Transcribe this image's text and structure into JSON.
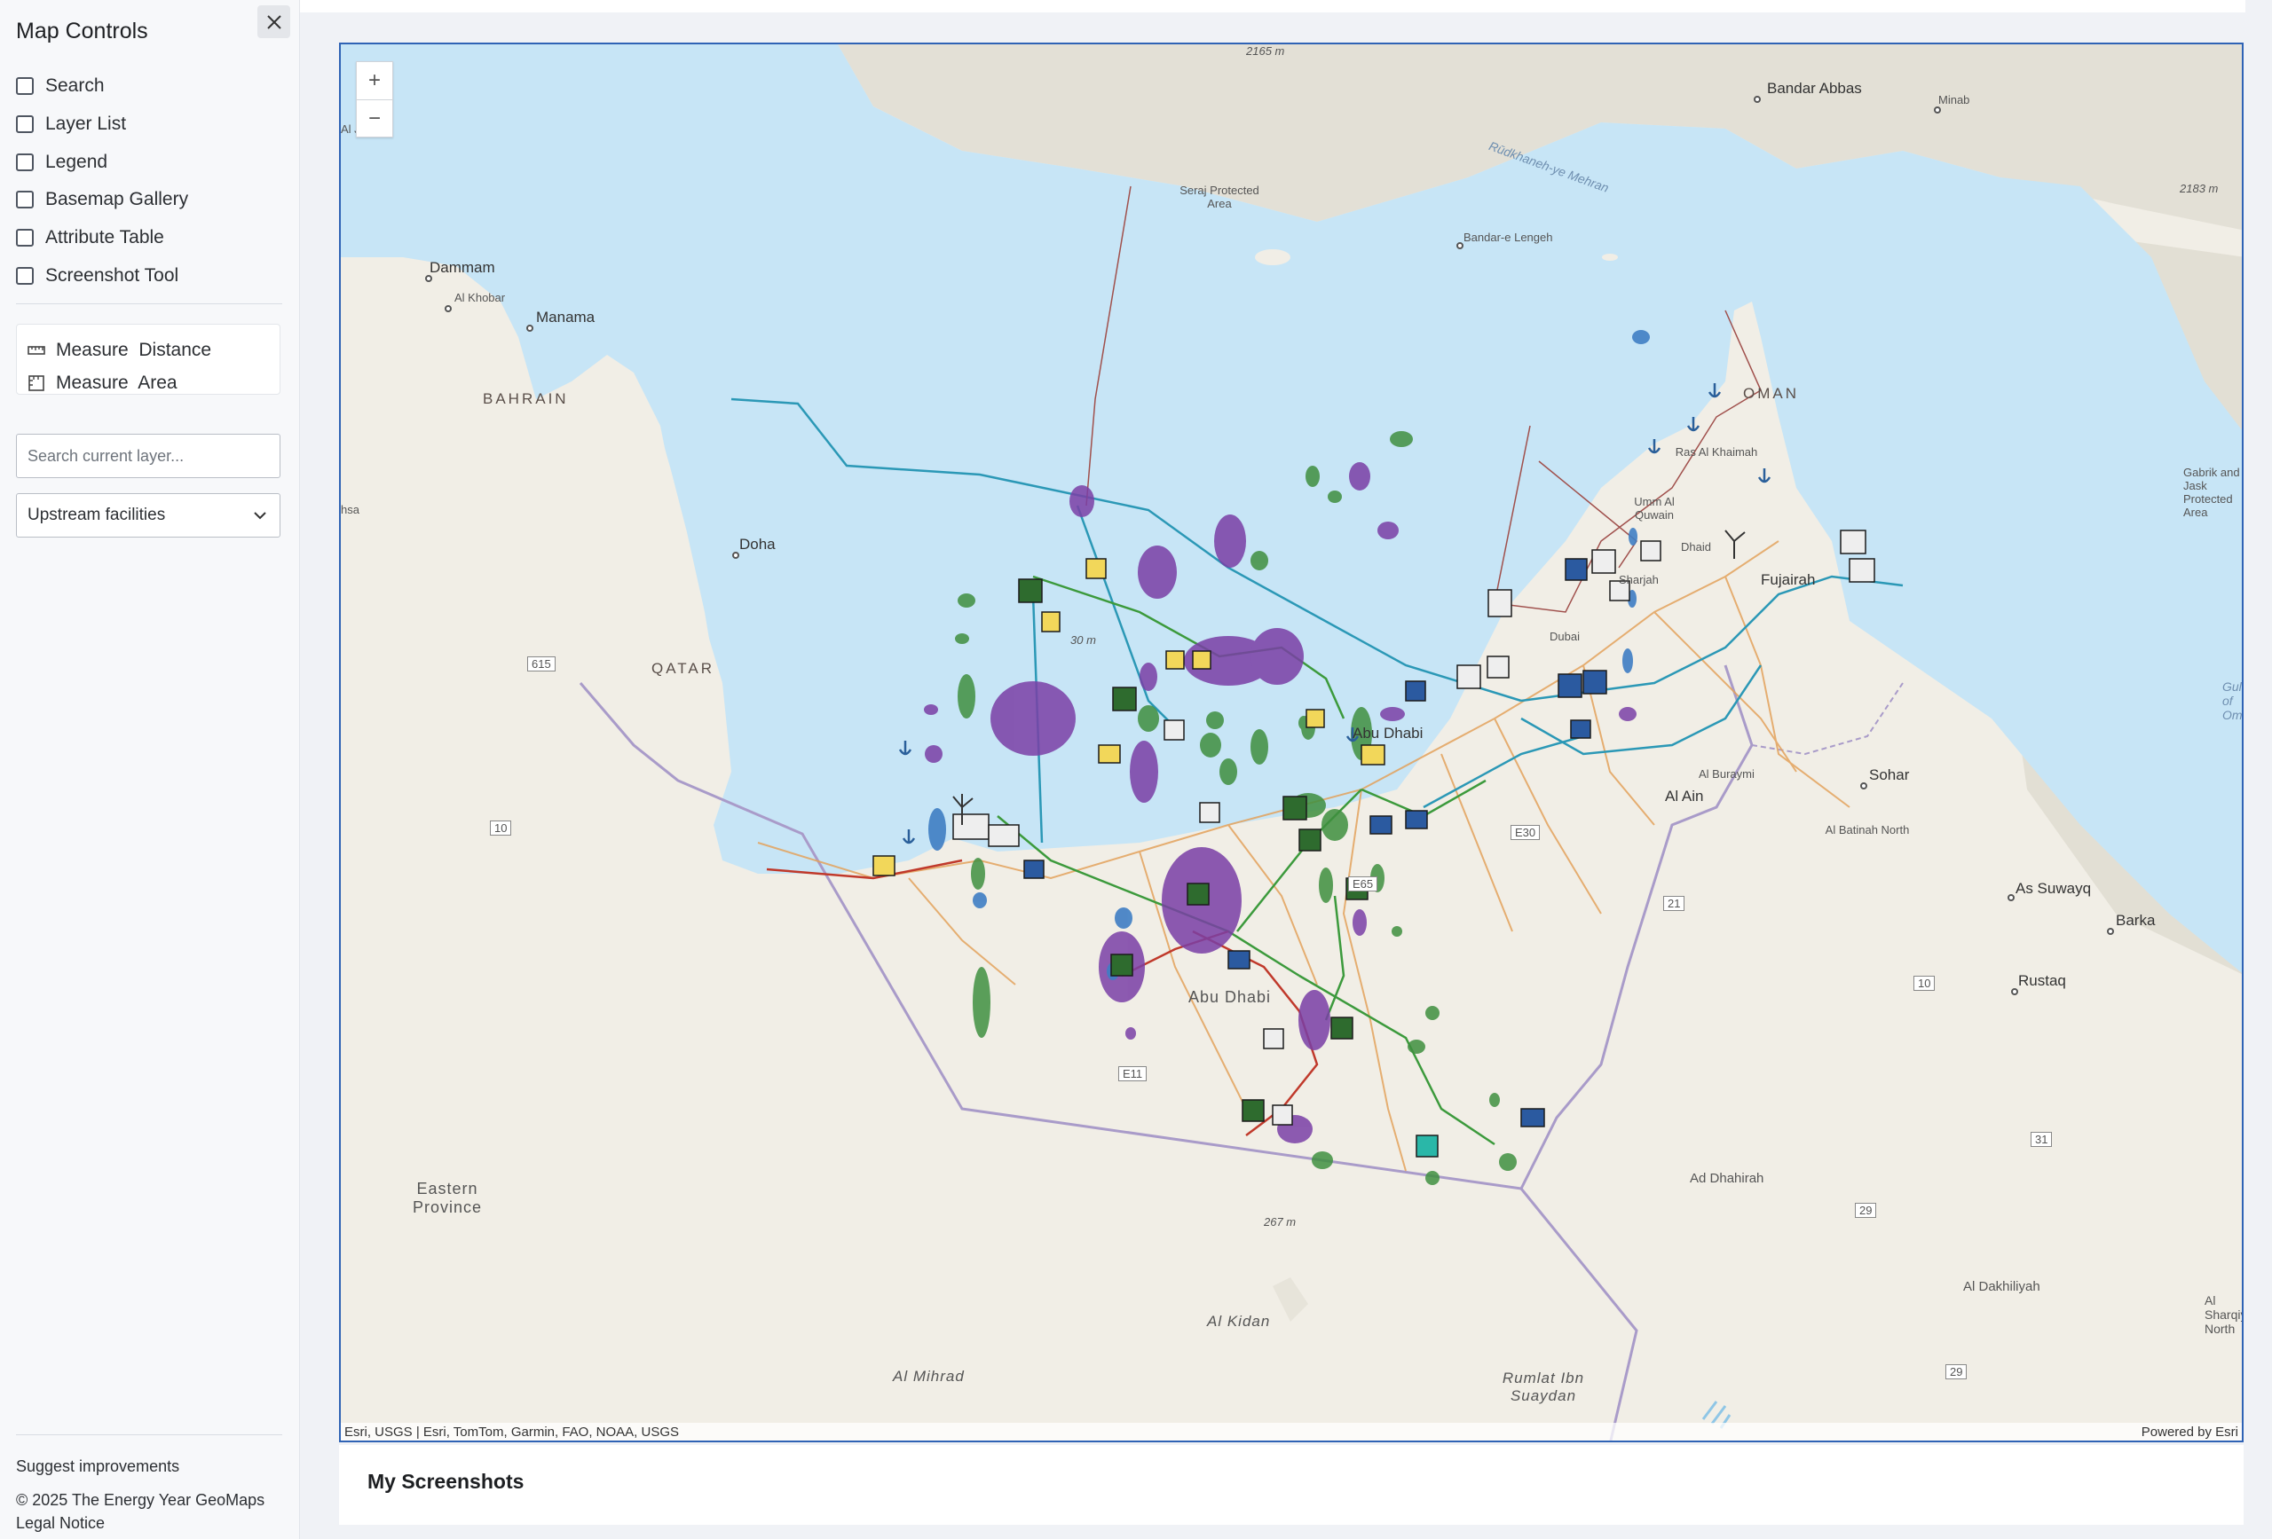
{
  "sidebar": {
    "title": "Map Controls",
    "close_icon": "close-icon",
    "widgets": [
      {
        "label": "Search",
        "checked": false
      },
      {
        "label": "Layer List",
        "checked": false
      },
      {
        "label": "Legend",
        "checked": false
      },
      {
        "label": "Basemap Gallery",
        "checked": false
      },
      {
        "label": "Attribute Table",
        "checked": false
      },
      {
        "label": "Screenshot Tool",
        "checked": false
      }
    ],
    "measure": {
      "distance_label": "Measure  Distance",
      "area_label": "Measure  Area",
      "distance_icon": "ruler-icon",
      "area_icon": "area-measure-icon"
    },
    "layer_search": {
      "placeholder": "Search current layer...",
      "value": ""
    },
    "layer_select": {
      "selected": "Upstream facilities"
    },
    "footer": {
      "suggest": "Suggest improvements",
      "copyright": "© 2025 The Energy Year GeoMaps",
      "legal": "Legal Notice"
    }
  },
  "map": {
    "zoom_in": "+",
    "zoom_out": "−",
    "attribution_left": "Esri, USGS | Esri, TomTom, Garmin, FAO, NOAA, USGS",
    "attribution_right": "Powered by Esri",
    "labels": {
      "aj": "Al J",
      "hsa": "hsa",
      "peak_2165": "2165 m",
      "bandar_abbas": "Bandar Abbas",
      "minab": "Minab",
      "peak_2183": "2183 m",
      "river": "Rūdkhaneh-ye Mehran",
      "seraj": "Seraj Protected Area",
      "bandar_lengeh": "Bandar-e Lengeh",
      "dammam": "Dammam",
      "al_khobar": "Al Khobar",
      "manama": "Manama",
      "bahrain": "BAHRAIN",
      "oman": "OMAN",
      "ras_al_khaimah": "Ras Al Khaimah",
      "umm_al_quwain": "Umm Al Quwain",
      "gabrik": "Gabrik and Jask Protected Area",
      "fujairah": "Fujairah",
      "dhaid": "Dhaid",
      "sharjah": "Sharjah",
      "dubai": "Dubai",
      "doha": "Doha",
      "qatar": "QATAR",
      "road_615": "615",
      "gulf_of_oman": "Gulf of Om",
      "abu_dhabi_city": "Abu Dhabi",
      "al_buraymi": "Al Buraymi",
      "sohar": "Sohar",
      "al_ain": "Al Ain",
      "al_batinah_north": "Al Batinah North",
      "road_10": "10",
      "road_e30": "E30",
      "road_e65": "E65",
      "road_21": "21",
      "as_suwayq": "As Suwayq",
      "barka": "Barka",
      "abu_dhabi_region": "Abu Dhabi",
      "rustaq": "Rustaq",
      "road_10b": "10",
      "road_e11": "E11",
      "road_31": "31",
      "ad_dhahirah": "Ad Dhahirah",
      "road_29": "29",
      "eastern_province": "Eastern Province",
      "peak_267": "267 m",
      "al_dakhiliyah": "Al Dakhiliyah",
      "al_sharqiyah": "Al Sharqiyah North",
      "al_kidan": "Al Kidan",
      "al_mihrad": "Al Mihrad",
      "rumlat": "Rumlat Ibn Suaydan",
      "road_29b": "29",
      "peak_sea": "30 m"
    }
  },
  "screenshots": {
    "title": "My Screenshots"
  }
}
